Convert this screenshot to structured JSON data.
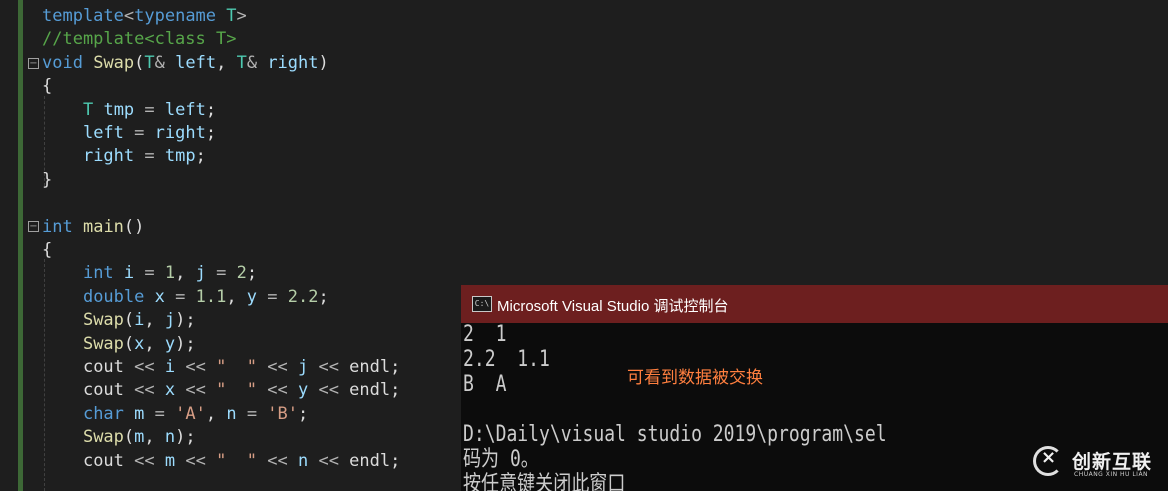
{
  "editor": {
    "lines": [
      {
        "tokens": [
          {
            "t": "template",
            "c": "kw"
          },
          {
            "t": "<",
            "c": "op"
          },
          {
            "t": "typename",
            "c": "kw"
          },
          {
            "t": " ",
            "c": "txt"
          },
          {
            "t": "T",
            "c": "type"
          },
          {
            "t": ">",
            "c": "op"
          }
        ]
      },
      {
        "tokens": [
          {
            "t": "//template<class T>",
            "c": "cm"
          }
        ]
      },
      {
        "tokens": [
          {
            "t": "void",
            "c": "kw"
          },
          {
            "t": " ",
            "c": "txt"
          },
          {
            "t": "Swap",
            "c": "fn"
          },
          {
            "t": "(",
            "c": "txt"
          },
          {
            "t": "T",
            "c": "type"
          },
          {
            "t": "& ",
            "c": "op"
          },
          {
            "t": "left",
            "c": "var"
          },
          {
            "t": ", ",
            "c": "txt"
          },
          {
            "t": "T",
            "c": "type"
          },
          {
            "t": "& ",
            "c": "op"
          },
          {
            "t": "right",
            "c": "var"
          },
          {
            "t": ")",
            "c": "txt"
          }
        ]
      },
      {
        "tokens": [
          {
            "t": "{",
            "c": "txt"
          }
        ]
      },
      {
        "tokens": [
          {
            "t": "    ",
            "c": "txt"
          },
          {
            "t": "T",
            "c": "type"
          },
          {
            "t": " ",
            "c": "txt"
          },
          {
            "t": "tmp",
            "c": "var"
          },
          {
            "t": " = ",
            "c": "op"
          },
          {
            "t": "left",
            "c": "var"
          },
          {
            "t": ";",
            "c": "txt"
          }
        ]
      },
      {
        "tokens": [
          {
            "t": "    ",
            "c": "txt"
          },
          {
            "t": "left",
            "c": "var"
          },
          {
            "t": " = ",
            "c": "op"
          },
          {
            "t": "right",
            "c": "var"
          },
          {
            "t": ";",
            "c": "txt"
          }
        ]
      },
      {
        "tokens": [
          {
            "t": "    ",
            "c": "txt"
          },
          {
            "t": "right",
            "c": "var"
          },
          {
            "t": " = ",
            "c": "op"
          },
          {
            "t": "tmp",
            "c": "var"
          },
          {
            "t": ";",
            "c": "txt"
          }
        ]
      },
      {
        "tokens": [
          {
            "t": "}",
            "c": "txt"
          }
        ]
      },
      {
        "tokens": []
      },
      {
        "tokens": [
          {
            "t": "int",
            "c": "kw"
          },
          {
            "t": " ",
            "c": "txt"
          },
          {
            "t": "main",
            "c": "fn"
          },
          {
            "t": "()",
            "c": "txt"
          }
        ]
      },
      {
        "tokens": [
          {
            "t": "{",
            "c": "txt"
          }
        ]
      },
      {
        "tokens": [
          {
            "t": "    ",
            "c": "txt"
          },
          {
            "t": "int",
            "c": "kw"
          },
          {
            "t": " ",
            "c": "txt"
          },
          {
            "t": "i",
            "c": "var"
          },
          {
            "t": " = ",
            "c": "op"
          },
          {
            "t": "1",
            "c": "num"
          },
          {
            "t": ", ",
            "c": "txt"
          },
          {
            "t": "j",
            "c": "var"
          },
          {
            "t": " = ",
            "c": "op"
          },
          {
            "t": "2",
            "c": "num"
          },
          {
            "t": ";",
            "c": "txt"
          }
        ]
      },
      {
        "tokens": [
          {
            "t": "    ",
            "c": "txt"
          },
          {
            "t": "double",
            "c": "kw"
          },
          {
            "t": " ",
            "c": "txt"
          },
          {
            "t": "x",
            "c": "var"
          },
          {
            "t": " = ",
            "c": "op"
          },
          {
            "t": "1.1",
            "c": "num"
          },
          {
            "t": ", ",
            "c": "txt"
          },
          {
            "t": "y",
            "c": "var"
          },
          {
            "t": " = ",
            "c": "op"
          },
          {
            "t": "2.2",
            "c": "num"
          },
          {
            "t": ";",
            "c": "txt"
          }
        ]
      },
      {
        "tokens": [
          {
            "t": "    ",
            "c": "txt"
          },
          {
            "t": "Swap",
            "c": "fn"
          },
          {
            "t": "(",
            "c": "txt"
          },
          {
            "t": "i",
            "c": "var"
          },
          {
            "t": ", ",
            "c": "txt"
          },
          {
            "t": "j",
            "c": "var"
          },
          {
            "t": ");",
            "c": "txt"
          }
        ]
      },
      {
        "tokens": [
          {
            "t": "    ",
            "c": "txt"
          },
          {
            "t": "Swap",
            "c": "fn"
          },
          {
            "t": "(",
            "c": "txt"
          },
          {
            "t": "x",
            "c": "var"
          },
          {
            "t": ", ",
            "c": "txt"
          },
          {
            "t": "y",
            "c": "var"
          },
          {
            "t": ");",
            "c": "txt"
          }
        ]
      },
      {
        "tokens": [
          {
            "t": "    ",
            "c": "txt"
          },
          {
            "t": "cout",
            "c": "txt"
          },
          {
            "t": " << ",
            "c": "op"
          },
          {
            "t": "i",
            "c": "var"
          },
          {
            "t": " << ",
            "c": "op"
          },
          {
            "t": "\"  \"",
            "c": "str"
          },
          {
            "t": " << ",
            "c": "op"
          },
          {
            "t": "j",
            "c": "var"
          },
          {
            "t": " << ",
            "c": "op"
          },
          {
            "t": "endl",
            "c": "txt"
          },
          {
            "t": ";",
            "c": "txt"
          }
        ]
      },
      {
        "tokens": [
          {
            "t": "    ",
            "c": "txt"
          },
          {
            "t": "cout",
            "c": "txt"
          },
          {
            "t": " << ",
            "c": "op"
          },
          {
            "t": "x",
            "c": "var"
          },
          {
            "t": " << ",
            "c": "op"
          },
          {
            "t": "\"  \"",
            "c": "str"
          },
          {
            "t": " << ",
            "c": "op"
          },
          {
            "t": "y",
            "c": "var"
          },
          {
            "t": " << ",
            "c": "op"
          },
          {
            "t": "endl",
            "c": "txt"
          },
          {
            "t": ";",
            "c": "txt"
          }
        ]
      },
      {
        "tokens": [
          {
            "t": "    ",
            "c": "txt"
          },
          {
            "t": "char",
            "c": "kw"
          },
          {
            "t": " ",
            "c": "txt"
          },
          {
            "t": "m",
            "c": "var"
          },
          {
            "t": " = ",
            "c": "op"
          },
          {
            "t": "'A'",
            "c": "str"
          },
          {
            "t": ", ",
            "c": "txt"
          },
          {
            "t": "n",
            "c": "var"
          },
          {
            "t": " = ",
            "c": "op"
          },
          {
            "t": "'B'",
            "c": "str"
          },
          {
            "t": ";",
            "c": "txt"
          }
        ]
      },
      {
        "tokens": [
          {
            "t": "    ",
            "c": "txt"
          },
          {
            "t": "Swap",
            "c": "fn"
          },
          {
            "t": "(",
            "c": "txt"
          },
          {
            "t": "m",
            "c": "var"
          },
          {
            "t": ", ",
            "c": "txt"
          },
          {
            "t": "n",
            "c": "var"
          },
          {
            "t": ");",
            "c": "txt"
          }
        ]
      },
      {
        "tokens": [
          {
            "t": "    ",
            "c": "txt"
          },
          {
            "t": "cout",
            "c": "txt"
          },
          {
            "t": " << ",
            "c": "op"
          },
          {
            "t": "m",
            "c": "var"
          },
          {
            "t": " << ",
            "c": "op"
          },
          {
            "t": "\"  \"",
            "c": "str"
          },
          {
            "t": " << ",
            "c": "op"
          },
          {
            "t": "n",
            "c": "var"
          },
          {
            "t": " << ",
            "c": "op"
          },
          {
            "t": "endl",
            "c": "txt"
          },
          {
            "t": ";",
            "c": "txt"
          }
        ]
      }
    ],
    "fold_markers": [
      "−",
      "−"
    ]
  },
  "console": {
    "title": "Microsoft Visual Studio 调试控制台",
    "icon_label": "C:\\",
    "icon": "console-window-icon",
    "lines": [
      "2  1",
      "2.2  1.1",
      "B  A",
      "",
      "D:\\Daily\\visual studio 2019\\program\\sel",
      "码为 0。",
      "按任意键关闭此窗口"
    ],
    "annotation": "可看到数据被交换"
  },
  "watermark": {
    "brand": "创新互联",
    "sub": "CHUANG XIN HU LIAN"
  },
  "colors": {
    "editor_bg": "#1e1e1e",
    "keyword": "#569cd6",
    "type": "#4ec9b0",
    "function": "#dcdcaa",
    "variable": "#9cdcfe",
    "number": "#b5cea8",
    "string": "#d69d85",
    "comment": "#57a64a",
    "console_title_bg": "#6d1f1f",
    "console_bg": "#0c0c0c",
    "annotation": "#ff7f3f"
  }
}
